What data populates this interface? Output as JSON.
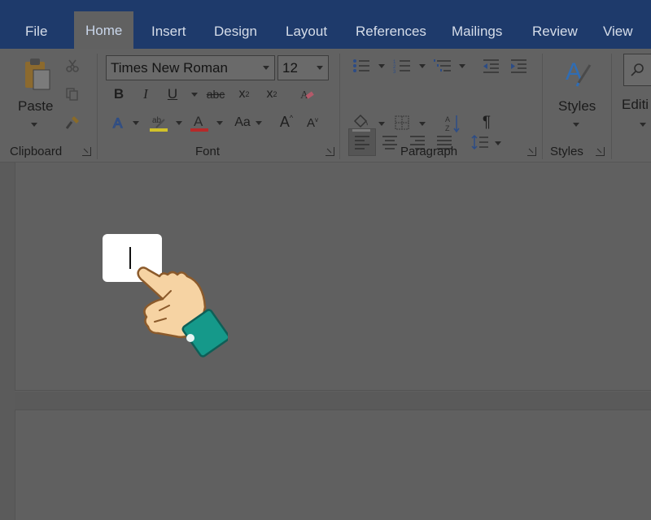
{
  "tabs": [
    {
      "id": "file",
      "label": "File"
    },
    {
      "id": "home",
      "label": "Home",
      "active": true
    },
    {
      "id": "insert",
      "label": "Insert"
    },
    {
      "id": "design",
      "label": "Design"
    },
    {
      "id": "layout",
      "label": "Layout"
    },
    {
      "id": "references",
      "label": "References"
    },
    {
      "id": "mailings",
      "label": "Mailings"
    },
    {
      "id": "review",
      "label": "Review"
    },
    {
      "id": "view",
      "label": "View"
    }
  ],
  "clipboard": {
    "paste_label": "Paste",
    "group_label": "Clipboard"
  },
  "font": {
    "family": "Times New Roman",
    "size": "12",
    "group_label": "Font",
    "bold": "B",
    "italic": "I",
    "underline": "U",
    "strikethrough": "abc",
    "subscript": "x",
    "subscript_mark": "2",
    "superscript": "x",
    "superscript_mark": "2",
    "change_case": "Aa",
    "grow": "A",
    "shrink": "A",
    "font_color": "#d32f2f",
    "highlight_color": "#e6d500"
  },
  "paragraph": {
    "group_label": "Paragraph",
    "pilcrow": "¶"
  },
  "styles": {
    "label": "Styles",
    "group_label": "Styles"
  },
  "editing": {
    "label": "Editi"
  },
  "colors": {
    "tabbar": "#1e3a6b",
    "ribbon": "#626262",
    "accent": "#2b579a",
    "hand_skin": "#f9d6a8",
    "cuff": "#11998e"
  }
}
